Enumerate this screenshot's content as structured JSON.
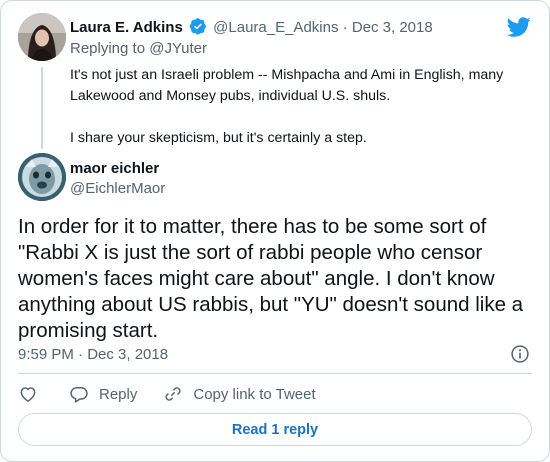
{
  "parent_tweet": {
    "author_name": "Laura E. Adkins",
    "author_handle": "@Laura_E_Adkins",
    "separator": "·",
    "date": "Dec 3, 2018",
    "replying_prefix": "Replying to",
    "replying_to": "@JYuter",
    "paragraphs": [
      "It's not just an Israeli problem -- Mishpacha and Ami in English, many Lakewood and Monsey pubs, individual U.S. shuls.",
      "I share your skepticism, but it's certainly a step."
    ]
  },
  "main_tweet": {
    "author_name": "maor eichler",
    "author_handle": "@EichlerMaor",
    "text": "In order for it to matter, there has to be some sort of \"Rabbi X is just the sort of rabbi people who censor women's faces might care about\" angle. I don't know anything about US rabbis, but \"YU\" doesn't sound like a promising start.",
    "timestamp": "9:59 PM · Dec 3, 2018"
  },
  "actions": {
    "reply_label": "Reply",
    "copy_label": "Copy link to Tweet"
  },
  "read_replies_label": "Read 1 reply",
  "icons": {
    "brand": "twitter-bird-icon",
    "verified": "verified-badge-icon",
    "info": "info-icon",
    "like": "heart-icon",
    "reply": "speech-bubble-icon",
    "copy": "link-icon"
  },
  "colors": {
    "twitter_blue": "#1d9bf0",
    "link_blue": "#1d71c2",
    "secondary_text": "#536471",
    "border": "#cfd9de"
  }
}
